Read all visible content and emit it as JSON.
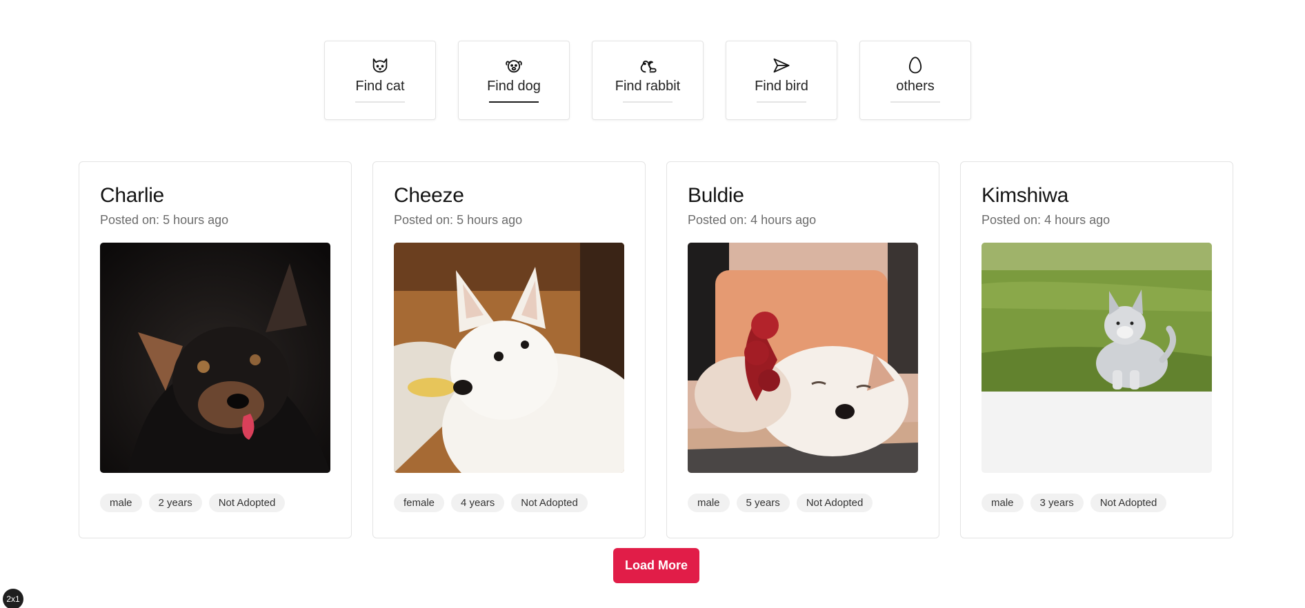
{
  "filters": [
    {
      "label": "Find cat",
      "icon": "cat-icon",
      "active": false
    },
    {
      "label": "Find dog",
      "icon": "dog-icon",
      "active": true
    },
    {
      "label": "Find rabbit",
      "icon": "squirrel-icon",
      "active": false
    },
    {
      "label": "Find bird",
      "icon": "send-icon",
      "active": false
    },
    {
      "label": "others",
      "icon": "egg-icon",
      "active": false
    }
  ],
  "pets": [
    {
      "name": "Charlie",
      "posted": "Posted on: 5 hours ago",
      "gender": "male",
      "age": "2 years",
      "status": "Not Adopted"
    },
    {
      "name": "Cheeze",
      "posted": "Posted on: 5 hours ago",
      "gender": "female",
      "age": "4 years",
      "status": "Not Adopted"
    },
    {
      "name": "Buldie",
      "posted": "Posted on: 4 hours ago",
      "gender": "male",
      "age": "5 years",
      "status": "Not Adopted"
    },
    {
      "name": "Kimshiwa",
      "posted": "Posted on: 4 hours ago",
      "gender": "male",
      "age": "3 years",
      "status": "Not Adopted"
    }
  ],
  "load_more_label": "Load More",
  "badge_label": "2x1",
  "colors": {
    "accent": "#e11d48",
    "active_underline": "#1a1a1a"
  }
}
